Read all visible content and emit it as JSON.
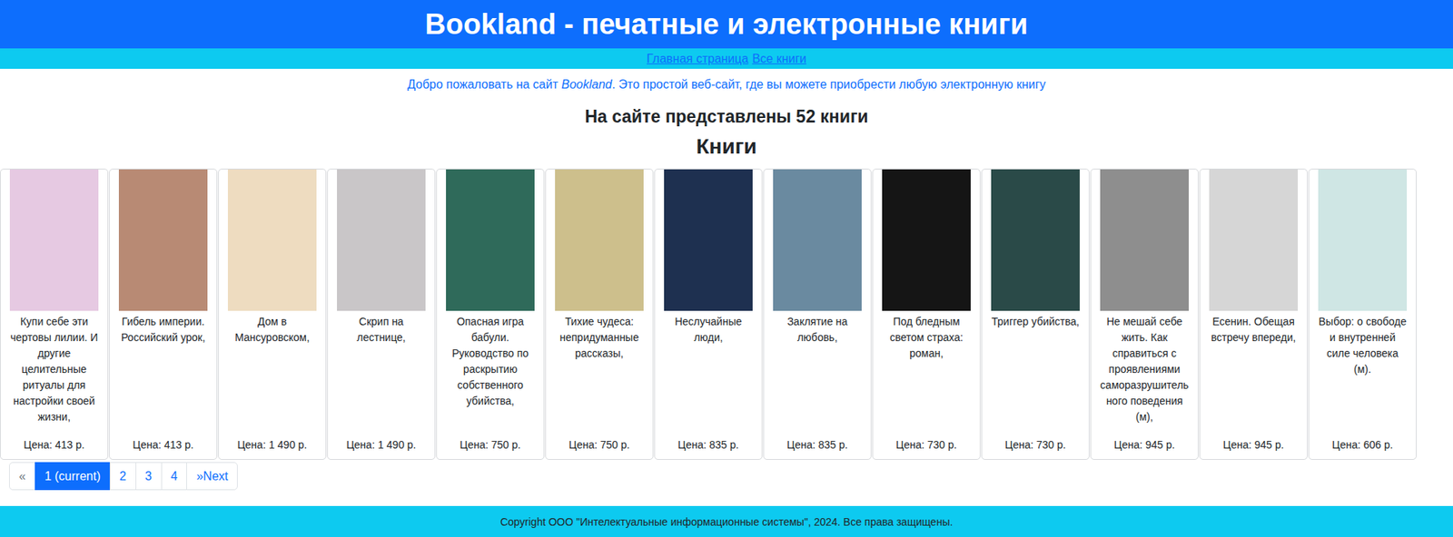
{
  "header": {
    "title": "Bookland - печатные и электронные книги"
  },
  "nav": {
    "links": [
      {
        "label": "Главная страница"
      },
      {
        "label": "Все книги"
      }
    ]
  },
  "welcome": {
    "before": "Добро пожаловать на сайт ",
    "emphasis": "Bookland",
    "after": ". Это простой веб-сайт, где вы можете приобрести любую электронную книгу"
  },
  "count_heading": "На сайте представлены 52 книги",
  "section_title": "Книги",
  "books": [
    {
      "title": "Купи себе эти чертовы лилии. И другие целительные ритуалы для настройки своей жизни,",
      "price": "Цена: 413 р.",
      "color": "#e6c9e2"
    },
    {
      "title": "Гибель империи. Российский урок,",
      "price": "Цена: 413 р.",
      "color": "#b88a74"
    },
    {
      "title": "Дом в Мансуровском,",
      "price": "Цена: 1 490 р.",
      "color": "#eedcc0"
    },
    {
      "title": "Скрип на лестнице,",
      "price": "Цена: 1 490 р.",
      "color": "#c9c6c8"
    },
    {
      "title": "Опасная игра бабули. Руководство по раскрытию собственного убийства,",
      "price": "Цена: 750 р.",
      "color": "#2f6a5a"
    },
    {
      "title": "Тихие чудеса: непридуманные рассказы,",
      "price": "Цена: 750 р.",
      "color": "#cdbf8c"
    },
    {
      "title": "Неслучайные люди,",
      "price": "Цена: 835 р.",
      "color": "#1e3050"
    },
    {
      "title": "Заклятие на любовь,",
      "price": "Цена: 835 р.",
      "color": "#6a8aa0"
    },
    {
      "title": "Под бледным светом страха: роман,",
      "price": "Цена: 730 р.",
      "color": "#151515"
    },
    {
      "title": "Триггер убийства,",
      "price": "Цена: 730 р.",
      "color": "#2a4a48"
    },
    {
      "title": "Не мешай себе жить. Как справиться с проявлениями саморазрушительного поведения (м),",
      "price": "Цена: 945 р.",
      "color": "#8e8e8e"
    },
    {
      "title": "Есенин. Обещая встречу впереди,",
      "price": "Цена: 945 р.",
      "color": "#d6d6d6"
    },
    {
      "title": "Выбор: о свободе и внутренней силе человека (м).",
      "price": "Цена: 606 р.",
      "color": "#cfe6e4"
    }
  ],
  "pagination": [
    {
      "label": "«",
      "selected": false,
      "disabled": true
    },
    {
      "label": "1 (current)",
      "selected": true,
      "disabled": false
    },
    {
      "label": "2",
      "selected": false,
      "disabled": false
    },
    {
      "label": "3",
      "selected": false,
      "disabled": false
    },
    {
      "label": "4",
      "selected": false,
      "disabled": false
    },
    {
      "label": "»Next",
      "selected": false,
      "disabled": false
    }
  ],
  "footer": {
    "text": "Copyright ООО \"Интелектуальные информационные системы\", 2024. Все права защищены."
  }
}
